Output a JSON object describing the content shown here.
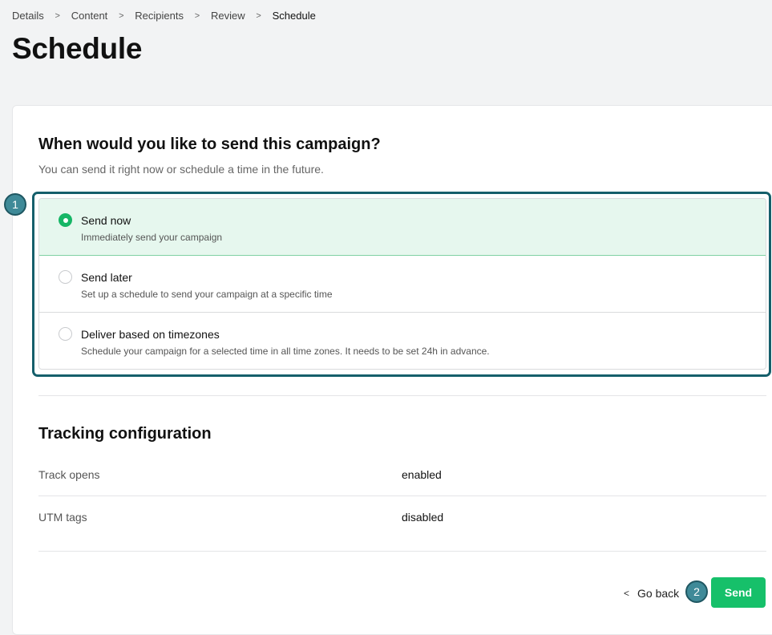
{
  "breadcrumb": [
    "Details",
    "Content",
    "Recipients",
    "Review",
    "Schedule"
  ],
  "page_title": "Schedule",
  "schedule": {
    "heading": "When would you like to send this campaign?",
    "subtitle": "You can send it right now or schedule a time in the future.",
    "options": [
      {
        "title": "Send now",
        "description": "Immediately send your campaign",
        "selected": true
      },
      {
        "title": "Send later",
        "description": "Set up a schedule to send your campaign at a specific time",
        "selected": false
      },
      {
        "title": "Deliver based on timezones",
        "description": "Schedule your campaign for a selected time in all time zones. It needs to be set 24h in advance.",
        "selected": false
      }
    ]
  },
  "tracking": {
    "title": "Tracking configuration",
    "rows": [
      {
        "label": "Track opens",
        "value": "enabled"
      },
      {
        "label": "UTM tags",
        "value": "disabled"
      }
    ]
  },
  "actions": {
    "go_back": "Go back",
    "send": "Send"
  },
  "markers": [
    "1",
    "2"
  ],
  "colors": {
    "accent_green": "#16c06a",
    "selected_bg": "#e6f7ee",
    "highlight_border": "#155f6b",
    "marker_fill": "#3f8a98"
  }
}
